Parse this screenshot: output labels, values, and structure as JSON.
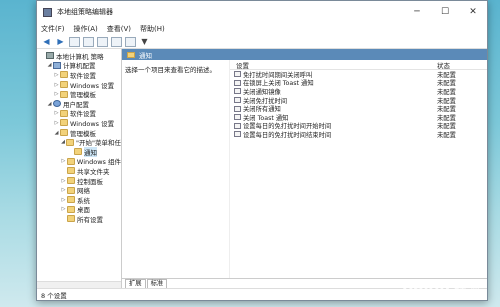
{
  "window": {
    "title": "本地组策略编辑器"
  },
  "window_controls": {
    "minimize": "─",
    "maximize": "☐",
    "close": "✕"
  },
  "menu": [
    "文件(F)",
    "操作(A)",
    "查看(V)",
    "帮助(H)"
  ],
  "tree": [
    {
      "label": "本地计算机 策略",
      "exp": "",
      "icon": "root",
      "indent": 0
    },
    {
      "label": "计算机配置",
      "exp": "◢",
      "icon": "comp",
      "indent": 1
    },
    {
      "label": "软件设置",
      "exp": "▷",
      "icon": "folder",
      "indent": 2
    },
    {
      "label": "Windows 设置",
      "exp": "▷",
      "icon": "folder",
      "indent": 2
    },
    {
      "label": "管理模板",
      "exp": "▷",
      "icon": "folder",
      "indent": 2
    },
    {
      "label": "用户配置",
      "exp": "◢",
      "icon": "user",
      "indent": 1
    },
    {
      "label": "软件设置",
      "exp": "▷",
      "icon": "folder",
      "indent": 2
    },
    {
      "label": "Windows 设置",
      "exp": "▷",
      "icon": "folder",
      "indent": 2
    },
    {
      "label": "管理模板",
      "exp": "◢",
      "icon": "folder",
      "indent": 2
    },
    {
      "label": "\"开始\"菜单和任",
      "exp": "◢",
      "icon": "folder",
      "indent": 3
    },
    {
      "label": "通知",
      "exp": "",
      "icon": "folder",
      "indent": 4,
      "selected": true
    },
    {
      "label": "Windows 组件",
      "exp": "▷",
      "icon": "folder",
      "indent": 3
    },
    {
      "label": "共享文件夹",
      "exp": "",
      "icon": "folder",
      "indent": 3
    },
    {
      "label": "控制面板",
      "exp": "▷",
      "icon": "folder",
      "indent": 3
    },
    {
      "label": "网络",
      "exp": "▷",
      "icon": "folder",
      "indent": 3
    },
    {
      "label": "系统",
      "exp": "▷",
      "icon": "folder",
      "indent": 3
    },
    {
      "label": "桌面",
      "exp": "▷",
      "icon": "folder",
      "indent": 3
    },
    {
      "label": "所有设置",
      "exp": "",
      "icon": "folder",
      "indent": 3
    }
  ],
  "right_header": "通知",
  "description": "选择一个项目来查看它的描述。",
  "columns": {
    "setting": "设置",
    "status": "状态"
  },
  "settings": [
    {
      "name": "免打扰时间期间关闭呼叫",
      "status": "未配置"
    },
    {
      "name": "在锁屏上关闭 Toast 通知",
      "status": "未配置"
    },
    {
      "name": "关闭通知镜像",
      "status": "未配置"
    },
    {
      "name": "关闭免打扰时间",
      "status": "未配置"
    },
    {
      "name": "关闭所有通知",
      "status": "未配置"
    },
    {
      "name": "关闭 Toast 通知",
      "status": "未配置"
    },
    {
      "name": "设置每日的免打扰时间开始时间",
      "status": "未配置"
    },
    {
      "name": "设置每日的免打扰时间结束时间",
      "status": "未配置"
    }
  ],
  "tabs": [
    "扩展",
    "标准"
  ],
  "status_bar": "8 个设置",
  "watermark": "Baidu 经验"
}
